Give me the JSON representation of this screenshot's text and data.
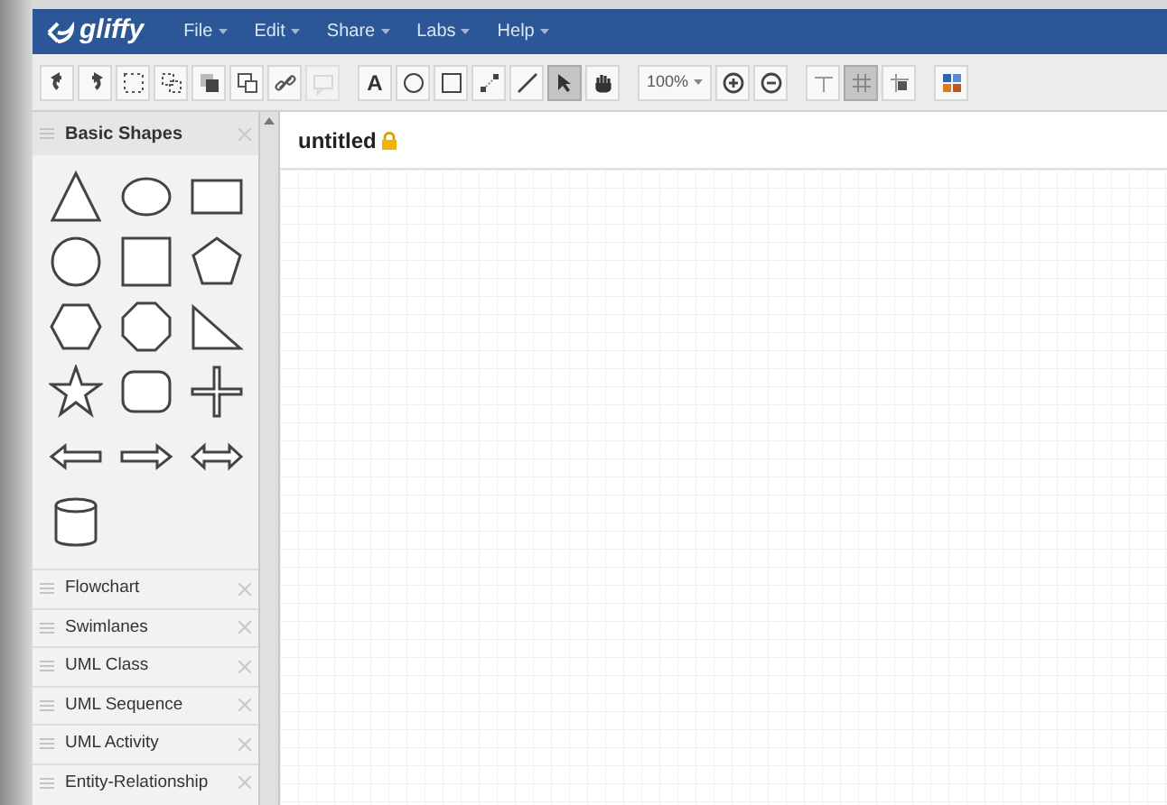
{
  "app": {
    "logo": "gliffy"
  },
  "menus": [
    {
      "label": "File"
    },
    {
      "label": "Edit"
    },
    {
      "label": "Share"
    },
    {
      "label": "Labs"
    },
    {
      "label": "Help"
    }
  ],
  "toolbar": [
    {
      "kind": "undo",
      "selected": false,
      "disabled": false
    },
    {
      "kind": "redo",
      "selected": false,
      "disabled": false
    },
    {
      "kind": "group",
      "selected": false,
      "disabled": false
    },
    {
      "kind": "ungroup",
      "selected": false,
      "disabled": false
    },
    {
      "kind": "front",
      "selected": false,
      "disabled": false
    },
    {
      "kind": "back",
      "selected": false,
      "disabled": false
    },
    {
      "kind": "link",
      "selected": false,
      "disabled": false
    },
    {
      "kind": "comment",
      "selected": false,
      "disabled": true
    },
    {
      "kind": "sep"
    },
    {
      "kind": "text",
      "label": "A",
      "selected": false,
      "disabled": false
    },
    {
      "kind": "ellipse",
      "selected": false,
      "disabled": false
    },
    {
      "kind": "rect",
      "selected": false,
      "disabled": false
    },
    {
      "kind": "connector",
      "selected": false,
      "disabled": false
    },
    {
      "kind": "line",
      "selected": false,
      "disabled": false
    },
    {
      "kind": "pointer",
      "selected": true,
      "disabled": false
    },
    {
      "kind": "hand",
      "selected": false,
      "disabled": false
    },
    {
      "kind": "sep"
    },
    {
      "kind": "zoom",
      "label": "100%",
      "selected": false,
      "disabled": false
    },
    {
      "kind": "zoomin",
      "selected": false,
      "disabled": false
    },
    {
      "kind": "zoomout",
      "selected": false,
      "disabled": false
    },
    {
      "kind": "sep"
    },
    {
      "kind": "guides",
      "selected": false,
      "disabled": false
    },
    {
      "kind": "grid",
      "selected": true,
      "disabled": false
    },
    {
      "kind": "snap",
      "selected": false,
      "disabled": false
    },
    {
      "kind": "sep"
    },
    {
      "kind": "theme",
      "selected": false,
      "disabled": false
    }
  ],
  "sidebar": {
    "panel": {
      "title": "Basic Shapes",
      "expanded": true
    },
    "shapes": [
      {
        "kind": "triangle"
      },
      {
        "kind": "ellipse"
      },
      {
        "kind": "rectangle"
      },
      {
        "kind": "circle"
      },
      {
        "kind": "square"
      },
      {
        "kind": "pentagon"
      },
      {
        "kind": "hexagon"
      },
      {
        "kind": "octagon"
      },
      {
        "kind": "right-triangle"
      },
      {
        "kind": "star"
      },
      {
        "kind": "rounded-rectangle"
      },
      {
        "kind": "cross"
      },
      {
        "kind": "left-arrow"
      },
      {
        "kind": "right-arrow"
      },
      {
        "kind": "double-arrow"
      },
      {
        "kind": "cylinder"
      }
    ],
    "libraries": [
      {
        "label": "Flowchart"
      },
      {
        "label": "Swimlanes"
      },
      {
        "label": "UML Class"
      },
      {
        "label": "UML Sequence"
      },
      {
        "label": "UML Activity"
      },
      {
        "label": "Entity-Relationship"
      }
    ]
  },
  "document": {
    "title": "untitled",
    "locked": true
  }
}
